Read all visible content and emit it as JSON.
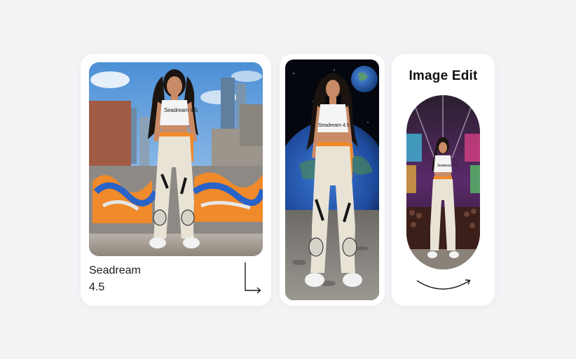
{
  "cards": {
    "main": {
      "title_line1": "Seadream",
      "title_line2": "4.5",
      "shirt_text": "Seadream 4.5"
    },
    "space": {
      "shirt_text": "Seadream 4.5"
    },
    "edit": {
      "heading": "Image Edit",
      "shirt_text": "Seadream 4.5"
    }
  },
  "icons": {
    "corner_arrow": "corner-down-right-arrow-icon",
    "curve_arrow": "curved-arrow-icon"
  },
  "colors": {
    "background": "#f3f3f6",
    "card": "#ffffff",
    "accent_orange": "#f08a2a"
  }
}
